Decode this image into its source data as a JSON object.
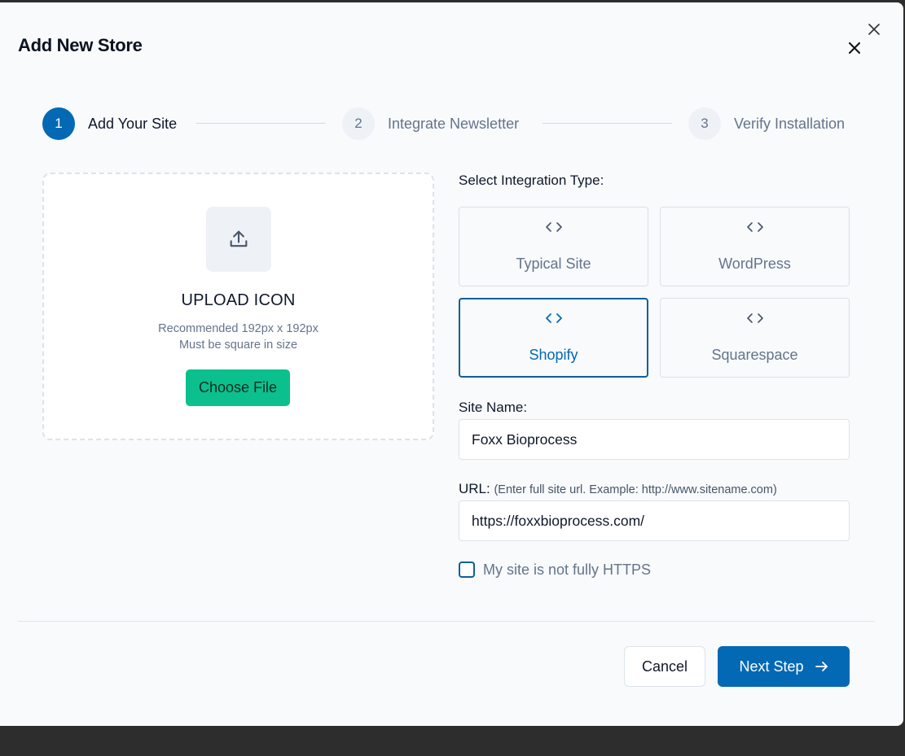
{
  "modal": {
    "title": "Add New Store"
  },
  "stepper": {
    "steps": [
      {
        "number": "1",
        "label": "Add Your Site"
      },
      {
        "number": "2",
        "label": "Integrate Newsletter"
      },
      {
        "number": "3",
        "label": "Verify Installation"
      }
    ],
    "active_index": 0
  },
  "upload": {
    "title": "UPLOAD ICON",
    "hint_line1": "Recommended 192px x 192px",
    "hint_line2": "Must be square in size",
    "button_label": "Choose File"
  },
  "integration": {
    "label": "Select Integration Type:",
    "options": [
      {
        "label": "Typical Site",
        "selected": false
      },
      {
        "label": "WordPress",
        "selected": false
      },
      {
        "label": "Shopify",
        "selected": true
      },
      {
        "label": "Squarespace",
        "selected": false
      }
    ]
  },
  "site_name": {
    "label": "Site Name:",
    "value": "Foxx Bioprocess"
  },
  "url": {
    "label": "URL:",
    "hint": "(Enter full site url. Example: http://www.sitename.com)",
    "value": "https://foxxbioprocess.com/"
  },
  "https_checkbox": {
    "label": "My site is not fully HTTPS",
    "checked": false
  },
  "footer": {
    "cancel_label": "Cancel",
    "next_label": "Next Step"
  },
  "colors": {
    "primary": "#0369b4",
    "accent_green": "#0cc08e",
    "muted_text": "#64748b"
  }
}
